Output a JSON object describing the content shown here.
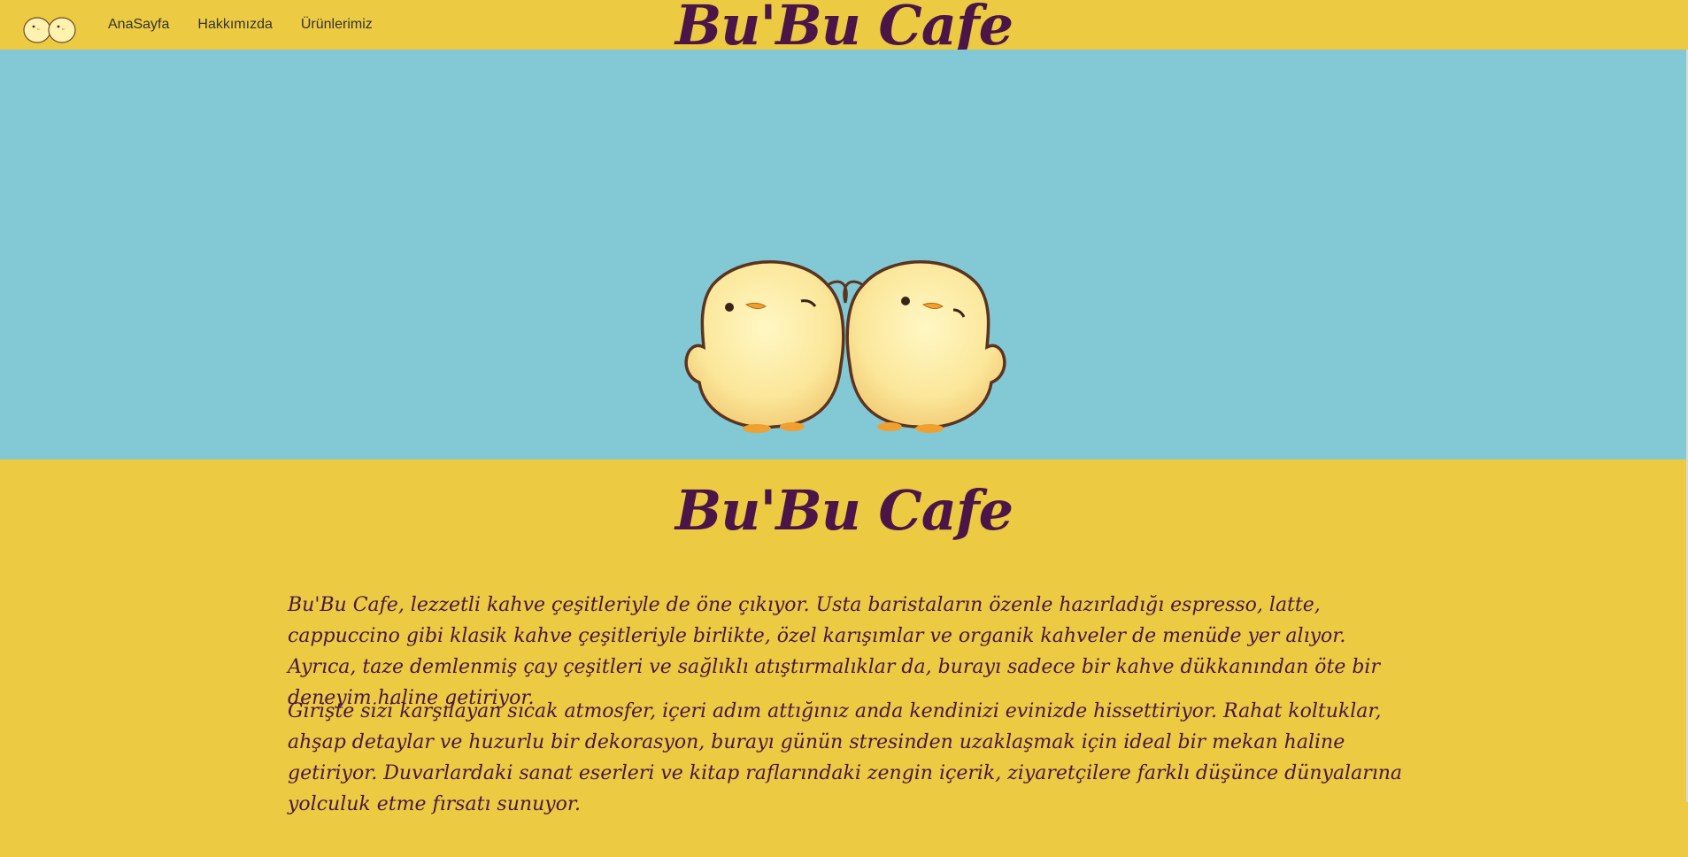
{
  "navbar": {
    "logo_icon": "two-chicks-logo-icon",
    "links": [
      "AnaSayfa",
      "Hakkımızda",
      "Ürünlerimiz"
    ],
    "title": "Bu'Bu Cafe"
  },
  "hero": {
    "image_icon": "two-chicks-illustration"
  },
  "content": {
    "title": "Bu'Bu Cafe",
    "paragraphs": [
      "Bu'Bu Cafe, lezzetli kahve çeşitleriyle de öne çıkıyor. Usta baristaların özenle hazırladığı espresso, latte, cappuccino gibi klasik kahve çeşitleriyle birlikte, özel karışımlar ve organik kahveler de menüde yer alıyor. Ayrıca, taze demlenmiş çay çeşitleri ve sağlıklı atıştırmalıklar da, burayı sadece bir kahve dükkanından öte bir deneyim haline getiriyor.",
      "Girişte sizi karşılayan sıcak atmosfer, içeri adım attığınız anda kendinizi evinizde hissettiriyor. Rahat koltuklar, ahşap detaylar ve huzurlu bir dekorasyon, burayı günün stresinden uzaklaşmak için ideal bir mekan haline getiriyor. Duvarlardaki sanat eserleri ve kitap raflarındaki zengin içerik, ziyaretçilere farklı düşünce dünyalarına yolculuk etme fırsatı sunuyor."
    ]
  },
  "colors": {
    "page_bg": "#ecca42",
    "hero_bg": "#82c9d5",
    "title_color": "#4b1547"
  }
}
